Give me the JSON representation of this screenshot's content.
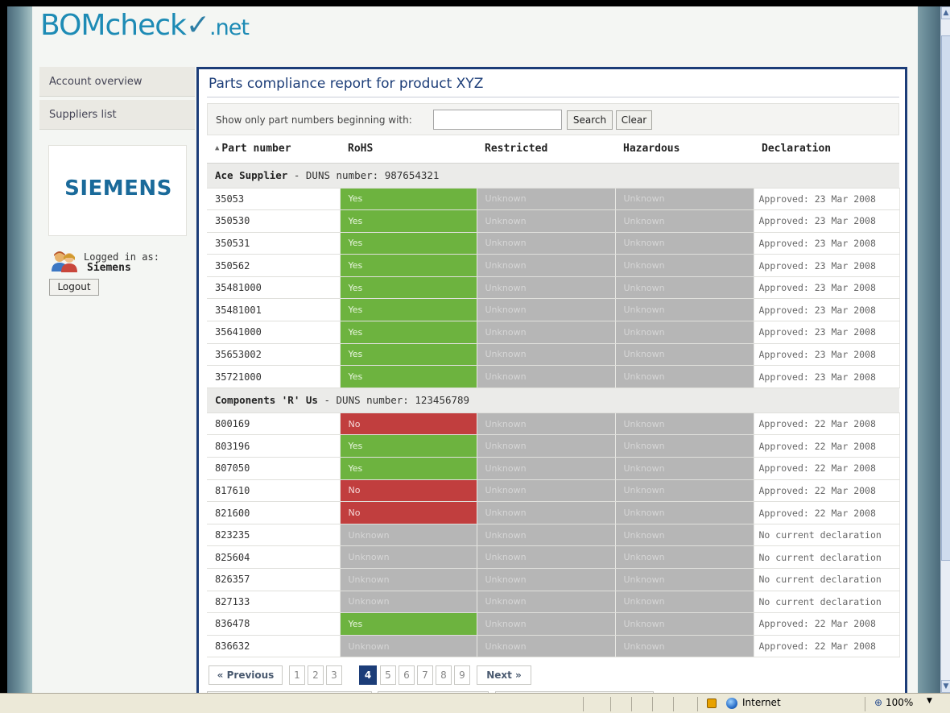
{
  "logo": {
    "brand": "BOMcheck",
    "suffix": ".net"
  },
  "nav": {
    "items": [
      {
        "label": "Account overview"
      },
      {
        "label": "Suppliers list"
      }
    ]
  },
  "company": {
    "logo_text": "SIEMENS"
  },
  "user": {
    "logged_in_label": "Logged in as:",
    "name": "Siemens",
    "logout_label": "Logout"
  },
  "report": {
    "title": "Parts compliance report for product XYZ"
  },
  "filter": {
    "label": "Show only part numbers beginning with:",
    "value": "",
    "search_label": "Search",
    "clear_label": "Clear"
  },
  "table": {
    "columns": [
      "Part number",
      "RoHS",
      "Restricted",
      "Hazardous",
      "Declaration"
    ],
    "groups": [
      {
        "supplier": "Ace Supplier",
        "duns_text": " - DUNS number: 987654321",
        "rows": [
          {
            "part": "35053",
            "rohs": "Yes",
            "restricted": "Unknown",
            "hazardous": "Unknown",
            "declaration": "Approved: 23 Mar 2008"
          },
          {
            "part": "350530",
            "rohs": "Yes",
            "restricted": "Unknown",
            "hazardous": "Unknown",
            "declaration": "Approved: 23 Mar 2008"
          },
          {
            "part": "350531",
            "rohs": "Yes",
            "restricted": "Unknown",
            "hazardous": "Unknown",
            "declaration": "Approved: 23 Mar 2008"
          },
          {
            "part": "350562",
            "rohs": "Yes",
            "restricted": "Unknown",
            "hazardous": "Unknown",
            "declaration": "Approved: 23 Mar 2008"
          },
          {
            "part": "35481000",
            "rohs": "Yes",
            "restricted": "Unknown",
            "hazardous": "Unknown",
            "declaration": "Approved: 23 Mar 2008"
          },
          {
            "part": "35481001",
            "rohs": "Yes",
            "restricted": "Unknown",
            "hazardous": "Unknown",
            "declaration": "Approved: 23 Mar 2008"
          },
          {
            "part": "35641000",
            "rohs": "Yes",
            "restricted": "Unknown",
            "hazardous": "Unknown",
            "declaration": "Approved: 23 Mar 2008"
          },
          {
            "part": "35653002",
            "rohs": "Yes",
            "restricted": "Unknown",
            "hazardous": "Unknown",
            "declaration": "Approved: 23 Mar 2008"
          },
          {
            "part": "35721000",
            "rohs": "Yes",
            "restricted": "Unknown",
            "hazardous": "Unknown",
            "declaration": "Approved: 23 Mar 2008"
          }
        ]
      },
      {
        "supplier": "Components 'R' Us",
        "duns_text": " - DUNS number: 123456789",
        "rows": [
          {
            "part": "800169",
            "rohs": "No",
            "restricted": "Unknown",
            "hazardous": "Unknown",
            "declaration": "Approved: 22 Mar 2008"
          },
          {
            "part": "803196",
            "rohs": "Yes",
            "restricted": "Unknown",
            "hazardous": "Unknown",
            "declaration": "Approved: 22 Mar 2008"
          },
          {
            "part": "807050",
            "rohs": "Yes",
            "restricted": "Unknown",
            "hazardous": "Unknown",
            "declaration": "Approved: 22 Mar 2008"
          },
          {
            "part": "817610",
            "rohs": "No",
            "restricted": "Unknown",
            "hazardous": "Unknown",
            "declaration": "Approved: 22 Mar 2008"
          },
          {
            "part": "821600",
            "rohs": "No",
            "restricted": "Unknown",
            "hazardous": "Unknown",
            "declaration": "Approved: 22 Mar 2008"
          },
          {
            "part": "823235",
            "rohs": "Unknown",
            "restricted": "Unknown",
            "hazardous": "Unknown",
            "declaration": "No current declaration"
          },
          {
            "part": "825604",
            "rohs": "Unknown",
            "restricted": "Unknown",
            "hazardous": "Unknown",
            "declaration": "No current declaration"
          },
          {
            "part": "826357",
            "rohs": "Unknown",
            "restricted": "Unknown",
            "hazardous": "Unknown",
            "declaration": "No current declaration"
          },
          {
            "part": "827133",
            "rohs": "Unknown",
            "restricted": "Unknown",
            "hazardous": "Unknown",
            "declaration": "No current declaration"
          },
          {
            "part": "836478",
            "rohs": "Yes",
            "restricted": "Unknown",
            "hazardous": "Unknown",
            "declaration": "Approved: 22 Mar 2008"
          },
          {
            "part": "836632",
            "rohs": "Unknown",
            "restricted": "Unknown",
            "hazardous": "Unknown",
            "declaration": "Approved: 22 Mar 2008"
          }
        ]
      }
    ]
  },
  "pagination": {
    "previous_label": "« Previous",
    "next_label": "Next »",
    "pages": [
      "1",
      "2",
      "3",
      "4",
      "5",
      "6",
      "7",
      "8",
      "9"
    ],
    "current": "4"
  },
  "statusbar": {
    "zone": "Internet",
    "zoom": "100%"
  },
  "colors": {
    "yes": "#6db33f",
    "no": "#c13e3e",
    "unknown": "#b6b6b6",
    "accent": "#1c3d78",
    "brand": "#1d8bb5"
  },
  "icons": {
    "sort": "sort-asc-icon",
    "user": "users-icon",
    "lock": "security-lock-icon",
    "globe": "internet-zone-icon",
    "zoom": "zoom-icon"
  }
}
